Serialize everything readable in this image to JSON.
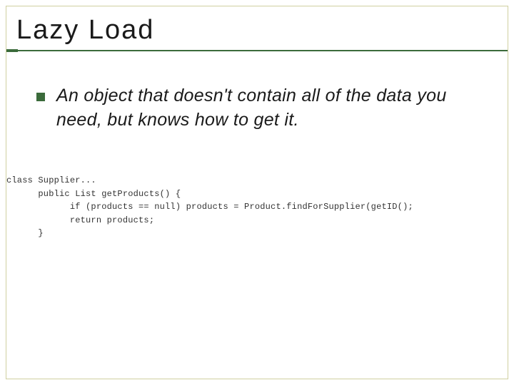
{
  "title": "Lazy Load",
  "bullet": {
    "text": "An object that doesn't contain all of the data you need, but knows how to get it."
  },
  "code_lines": {
    "l1": "class Supplier...",
    "l2": "      public List getProducts() {",
    "l3": "            if (products == null) products = Product.findForSupplier(getID();",
    "l4": "            return products;",
    "l5": "      }"
  }
}
